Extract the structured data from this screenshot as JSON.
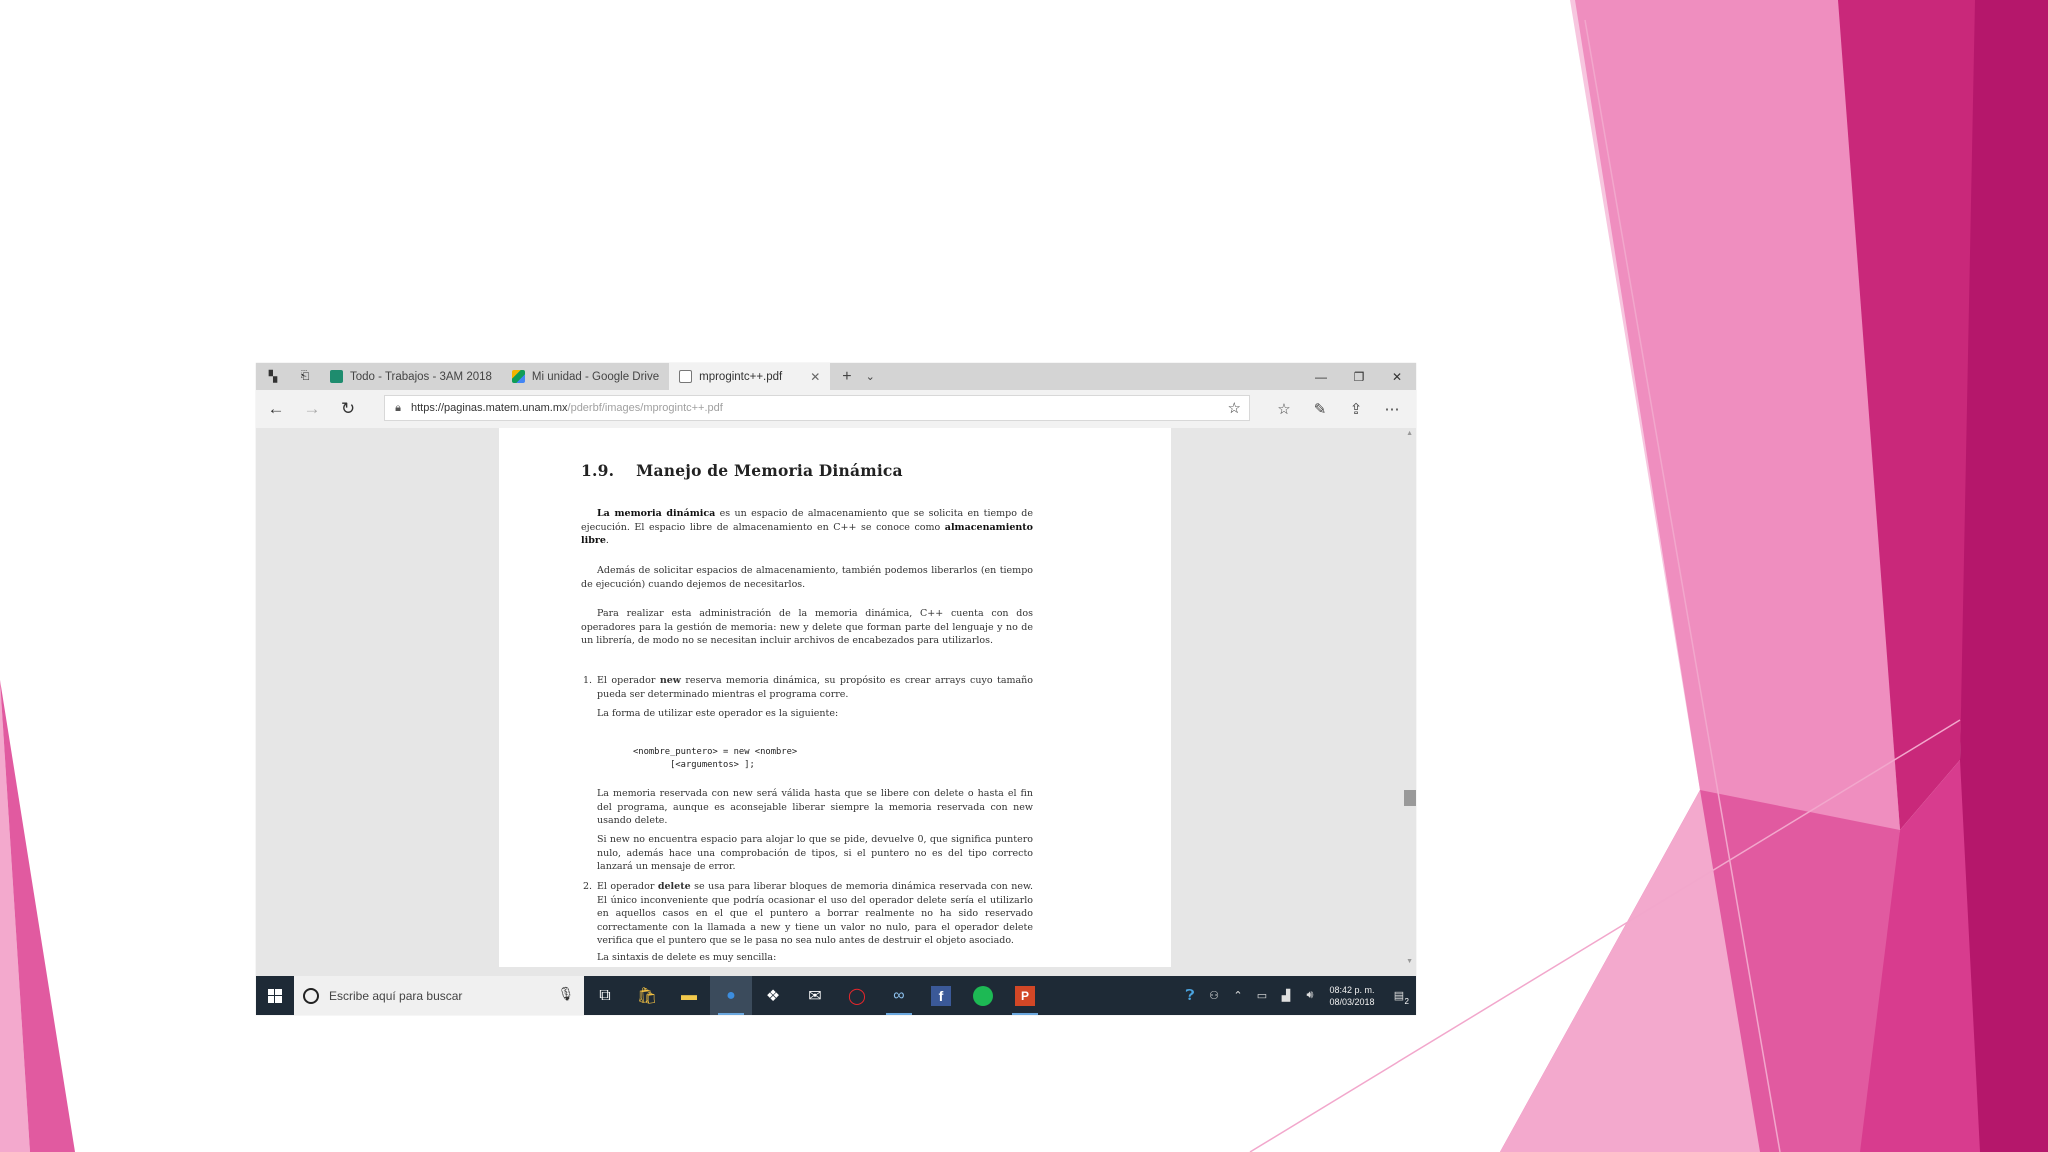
{
  "slide": {
    "colors": {
      "pink_dark": "#b5176b",
      "pink_mid": "#d83c8e",
      "pink_light": "#ef8ebf",
      "pink_pale": "#f7c6df"
    }
  },
  "browser": {
    "tabs": [
      {
        "label": "Todo - Trabajos - 3AM 2018",
        "icon": "classroom-icon",
        "color": "#1e8c6e"
      },
      {
        "label": "Mi unidad - Google Drive",
        "icon": "google-drive-icon",
        "color": "#3b9a4e"
      },
      {
        "label": "mprogintc++.pdf",
        "icon": "pdf-tab-icon",
        "color": "#777777"
      }
    ],
    "new_tab_label": "+",
    "address": {
      "host": "https://paginas.matem.unam.mx",
      "path": "/pderbf/images/mprogintc++.pdf"
    }
  },
  "pdf": {
    "section_number": "1.9.",
    "section_title": "Manejo de Memoria Dinámica",
    "p1_bold1": "La memoria dinámica",
    "p1_text1": " es un espacio de almacenamiento que se solicita en tiempo de ejecución. El espacio libre de almacenamiento en C++ se conoce como ",
    "p1_bold2": "almacenamiento libre",
    "p1_text2": ".",
    "p2": "Además de solicitar espacios de almacenamiento, también podemos liberarlos (en tiempo de ejecución) cuando dejemos de necesitarlos.",
    "p3": "Para realizar esta administración de la memoria dinámica, C++ cuenta con dos operadores para la gestión de memoria: new y delete que forman parte del lenguaje y no de un librería, de modo no se necesitan incluir archivos de encabezados para utilizarlos.",
    "item1_num": "1.",
    "item1_a": "El operador ",
    "item1_bold": "new",
    "item1_b": " reserva memoria dinámica, su propósito es crear arrays cuyo tamaño pueda ser determinado mientras el programa corre.",
    "item1_c": "La forma de utilizar este operador es la siguiente:",
    "code_line1": "<nombre_puntero> = new <nombre>",
    "code_line2": "       [<argumentos> ];",
    "item1_d": "La memoria reservada con new será válida hasta que se libere con delete o hasta el fin del programa, aunque es aconsejable liberar siempre la memoria reservada con new usando delete.",
    "item1_e": "Si new no encuentra espacio para alojar lo que se pide, devuelve 0, que significa puntero nulo, además hace una comprobación de tipos, si el puntero no es del tipo correcto lanzará un mensaje de error.",
    "item2_num": "2.",
    "item2_a": "El operador ",
    "item2_bold": "delete",
    "item2_b": " se usa para liberar bloques de memoria dinámica reservada con new. El único inconveniente que podría ocasionar el uso del operador delete sería el utilizarlo en aquellos casos en el que el puntero a borrar realmente no ha sido reservado correctamente con la llamada a new y tiene un valor no nulo, para el operador delete verifica que el puntero que se le pasa no sea nulo antes de destruir el objeto asociado.",
    "item2_c": "La sintaxis de delete es muy sencilla:"
  },
  "taskbar": {
    "search_placeholder": "Escribe aquí para buscar",
    "time": "08:42 p. m.",
    "date": "08/03/2018",
    "notification_count": "2"
  }
}
